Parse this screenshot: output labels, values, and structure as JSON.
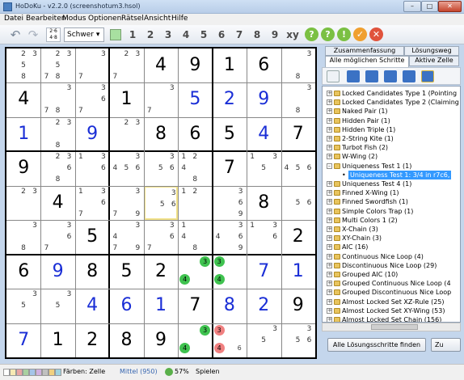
{
  "window": {
    "title": "HoDoKu - v2.2.0  (screenshotum3.hsol)",
    "min": "–",
    "max": "□",
    "close": "✕"
  },
  "menu": [
    "Datei",
    "Bearbeiten",
    "Modus",
    "Optionen",
    "Rätsel",
    "Ansicht",
    "Hilfe"
  ],
  "toolbar": {
    "undo": "↶",
    "redo": "↷",
    "difficulty": "Schwer ▾",
    "digits": [
      "1",
      "2",
      "3",
      "4",
      "5",
      "6",
      "7",
      "8",
      "9"
    ],
    "xy": "xy",
    "hints": [
      "?",
      "?",
      "!",
      "✓",
      "✕"
    ],
    "colors": {
      "green": "#7bc043",
      "orange": "#f0a030",
      "red": "#e0533c"
    }
  },
  "board": {
    "rows": [
      [
        {
          "c": [
            2,
            3,
            5,
            8
          ]
        },
        {
          "c": [
            2,
            3,
            5,
            7,
            8
          ]
        },
        {
          "c": [
            3,
            7
          ]
        },
        {
          "c": [
            2,
            3,
            7
          ]
        },
        {
          "v": "4",
          "g": true
        },
        {
          "v": "9",
          "g": true
        },
        {
          "v": "1",
          "g": true
        },
        {
          "v": "6",
          "g": true
        },
        {
          "c": [
            3,
            8
          ]
        }
      ],
      [
        {
          "v": "4",
          "g": true
        },
        {
          "c": [
            3,
            7,
            8
          ]
        },
        {
          "c": [
            3,
            6,
            7
          ]
        },
        {
          "v": "1",
          "g": true
        },
        {
          "c": [
            3,
            7
          ]
        },
        {
          "v": "5",
          "g": false
        },
        {
          "v": "2",
          "g": false
        },
        {
          "v": "9",
          "g": false
        },
        {
          "c": [
            3,
            8
          ]
        }
      ],
      [
        {
          "v": "1",
          "g": false
        },
        {
          "c": [
            2,
            3,
            8
          ]
        },
        {
          "v": "9",
          "g": false
        },
        {
          "c": [
            2,
            3
          ]
        },
        {
          "v": "8",
          "g": true
        },
        {
          "v": "6",
          "g": true
        },
        {
          "v": "5",
          "g": true
        },
        {
          "v": "4",
          "g": false
        },
        {
          "v": "7",
          "g": true
        }
      ],
      [
        {
          "v": "9",
          "g": true
        },
        {
          "c": [
            2,
            3,
            6,
            8
          ]
        },
        {
          "c": [
            1,
            3,
            6
          ]
        },
        {
          "c": [
            3,
            4,
            5,
            6
          ]
        },
        {
          "c": [
            3,
            5,
            6
          ]
        },
        {
          "c": [
            1,
            2,
            4,
            8
          ]
        },
        {
          "v": "7",
          "g": true
        },
        {
          "c": [
            1,
            3,
            5
          ]
        },
        {
          "c": [
            4,
            5,
            6
          ]
        }
      ],
      [
        {
          "c": [
            2,
            3
          ]
        },
        {
          "v": "4",
          "g": true
        },
        {
          "c": [
            1,
            3,
            6,
            7
          ]
        },
        {
          "c": [
            3,
            7,
            9
          ]
        },
        {
          "c": [
            3,
            5,
            6
          ],
          "sel": true
        },
        {
          "c": [
            1,
            2
          ]
        },
        {
          "c": [
            3,
            6,
            9
          ]
        },
        {
          "v": "8",
          "g": true
        },
        {
          "c": [
            5,
            6
          ]
        }
      ],
      [
        {
          "c": [
            3,
            8
          ]
        },
        {
          "c": [
            3,
            6,
            7
          ]
        },
        {
          "v": "5",
          "g": true
        },
        {
          "c": [
            3,
            4,
            7,
            9
          ]
        },
        {
          "c": [
            3,
            6,
            7
          ]
        },
        {
          "c": [
            1,
            4,
            8
          ]
        },
        {
          "c": [
            3,
            4,
            6,
            9
          ]
        },
        {
          "c": [
            1,
            3,
            6
          ]
        },
        {
          "v": "2",
          "g": true
        }
      ],
      [
        {
          "v": "6",
          "g": true
        },
        {
          "v": "9",
          "g": false
        },
        {
          "v": "8",
          "g": true
        },
        {
          "v": "5",
          "g": true
        },
        {
          "v": "2",
          "g": true
        },
        {
          "h": [
            [
              "3",
              "#3fc24f",
              "tr"
            ],
            [
              "4",
              "#3fc24f",
              "ml"
            ]
          ]
        },
        {
          "h": [
            [
              "3",
              "#3fc24f",
              "tl"
            ],
            [
              "4",
              "#3fc24f",
              "ml"
            ]
          ]
        },
        {
          "v": "7",
          "g": false
        },
        {
          "v": "1",
          "g": false
        }
      ],
      [
        {
          "c": [
            3,
            5
          ]
        },
        {
          "c": [
            3,
            5
          ]
        },
        {
          "v": "4",
          "g": false
        },
        {
          "v": "6",
          "g": false
        },
        {
          "v": "1",
          "g": false
        },
        {
          "v": "7",
          "g": true
        },
        {
          "v": "8",
          "g": false
        },
        {
          "v": "2",
          "g": false
        },
        {
          "v": "9",
          "g": true
        }
      ],
      [
        {
          "v": "7",
          "g": false
        },
        {
          "v": "1",
          "g": true
        },
        {
          "v": "2",
          "g": true
        },
        {
          "v": "8",
          "g": true
        },
        {
          "v": "9",
          "g": true
        },
        {
          "h": [
            [
              "3",
              "#3fc24f",
              "tr"
            ],
            [
              "4",
              "#3fc24f",
              "ml"
            ]
          ]
        },
        {
          "h": [
            [
              "3",
              "#f08080",
              "tl"
            ],
            [
              "4",
              "#f08080",
              "ml"
            ],
            [
              "6",
              "#888",
              "mr"
            ]
          ]
        },
        {
          "c": [
            3,
            5
          ]
        },
        {
          "c": [
            3,
            5,
            6
          ]
        }
      ]
    ]
  },
  "panel": {
    "tabs": {
      "summary": "Zusammenfassung",
      "solution": "Lösungsweg",
      "all_steps": "Alle möglichen Schritte",
      "active_cell": "Aktive Zelle"
    },
    "steps": [
      {
        "label": "Locked Candidates Type 1 (Pointing",
        "expander": "+"
      },
      {
        "label": "Locked Candidates Type 2 (Claiming",
        "expander": "+"
      },
      {
        "label": "Naked Pair (1)",
        "expander": "+"
      },
      {
        "label": "Hidden Pair (1)",
        "expander": "+"
      },
      {
        "label": "Hidden Triple (1)",
        "expander": "+"
      },
      {
        "label": "2-String Kite (1)",
        "expander": "+"
      },
      {
        "label": "Turbot Fish (2)",
        "expander": "+"
      },
      {
        "label": "W-Wing (2)",
        "expander": "+"
      },
      {
        "label": "Uniqueness Test 1 (1)",
        "expander": "–"
      },
      {
        "label": "Uniqueness Test 1: 3/4 in r7c6,",
        "child": true,
        "selected": true
      },
      {
        "label": "Uniqueness Test 4 (1)",
        "expander": "+"
      },
      {
        "label": "Finned X-Wing (1)",
        "expander": "+"
      },
      {
        "label": "Finned Swordfish (1)",
        "expander": "+"
      },
      {
        "label": "Simple Colors Trap (1)",
        "expander": "+"
      },
      {
        "label": "Multi Colors 1 (2)",
        "expander": "+"
      },
      {
        "label": "X-Chain (3)",
        "expander": "+"
      },
      {
        "label": "XY-Chain (3)",
        "expander": "+"
      },
      {
        "label": "AIC (16)",
        "expander": "+"
      },
      {
        "label": "Continuous Nice Loop (4)",
        "expander": "+"
      },
      {
        "label": "Discontinuous Nice Loop (29)",
        "expander": "+"
      },
      {
        "label": "Grouped AIC (10)",
        "expander": "+"
      },
      {
        "label": "Grouped Continuous Nice Loop (4",
        "expander": "+"
      },
      {
        "label": "Grouped Discontinuous Nice Loop",
        "expander": "+"
      },
      {
        "label": "Almost Locked Set XZ-Rule (25)",
        "expander": "+"
      },
      {
        "label": "Almost Locked Set XY-Wing (53)",
        "expander": "+"
      },
      {
        "label": "Almost Locked Set Chain (156)",
        "expander": "+"
      }
    ],
    "find_all": "Alle Lösungsschritte finden",
    "apply": "Zu"
  },
  "status": {
    "colors_label": "Färben: Zelle",
    "level": "Mittel (950)",
    "progress": "57%",
    "mode": "Spielen",
    "swatches": [
      "#ffffff",
      "#f7e9b4",
      "#e8a4a4",
      "#a9d0a0",
      "#a4c4e8",
      "#d0b0e0",
      "#c0c0c0",
      "#f0d080",
      "#9fd3e0"
    ]
  }
}
